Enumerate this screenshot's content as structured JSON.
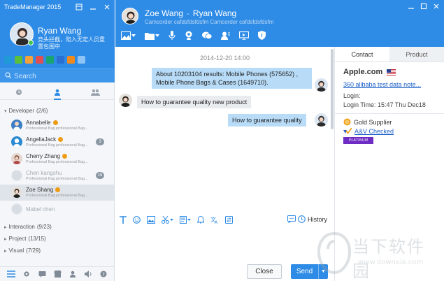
{
  "app": {
    "title": "TradeManager 2015"
  },
  "me": {
    "name": "Ryan Wang",
    "signature": "竞头拦截，陷入无定人员重置包围中"
  },
  "search": {
    "placeholder": "Search"
  },
  "groups": {
    "developer": {
      "label": "Developer",
      "count": "(2/6)"
    },
    "interaction": {
      "label": "Interaction",
      "count": "(9/23)"
    },
    "project": {
      "label": "Project",
      "count": "(13/15)"
    },
    "visual": {
      "label": "Visual",
      "count": "(7/29)"
    }
  },
  "contacts": [
    {
      "name": "Annabelle",
      "signature": "Professional Bag professional Bag...",
      "count": ""
    },
    {
      "name": "AngeliaJack",
      "signature": "Professional Bag professional Bag...",
      "count": "3"
    },
    {
      "name": "Cherry Zhang",
      "signature": "Professional Bag professional Bag...",
      "count": ""
    },
    {
      "name": "Chen kangshu",
      "signature": "Professional Bag professional Bag...",
      "count": "15"
    },
    {
      "name": "Zoe Shang",
      "signature": "Professional Bag professional Bag...",
      "count": ""
    },
    {
      "name": "Mabel chen",
      "signature": "",
      "count": ""
    }
  ],
  "chat": {
    "peer_name": "Zoe Wang",
    "separator": "-",
    "peer_company": "Ryan Wang",
    "peer_signature": "Camcorder cafdsfdsfdsfm Camcorder cafdsfdsfdsfm",
    "timestamp": "2014-12-20  14:00",
    "messages": [
      {
        "text": "About 10203104 results: Mobile Phones (575652) , Mobile Phone Bags & Cases (1649710)."
      },
      {
        "text": "How to guarantee quality new product"
      },
      {
        "text": "How to guarantee quality"
      }
    ],
    "history_label": "History",
    "close_label": "Close",
    "send_label": "Send"
  },
  "info": {
    "tabs": {
      "contact": "Contact",
      "product": "Product"
    },
    "company": "Apple.com",
    "link": "360 alibaba test data note...",
    "login_label": "Login:",
    "login_time": "Login Time: 15:47 Thu Dec18",
    "gold_supplier": "Gold Supplier",
    "av_checked": "A&V Checked",
    "platinum": "PLATINUM"
  },
  "watermark": {
    "text": "当下软件园",
    "url": "www.downxia.com"
  },
  "colors": {
    "brand": "#2f8ce6",
    "out_bubble": "#b8dcf8",
    "in_bubble": "#e9ecef",
    "link": "#1a5fc7",
    "badge": "#f09b14"
  }
}
